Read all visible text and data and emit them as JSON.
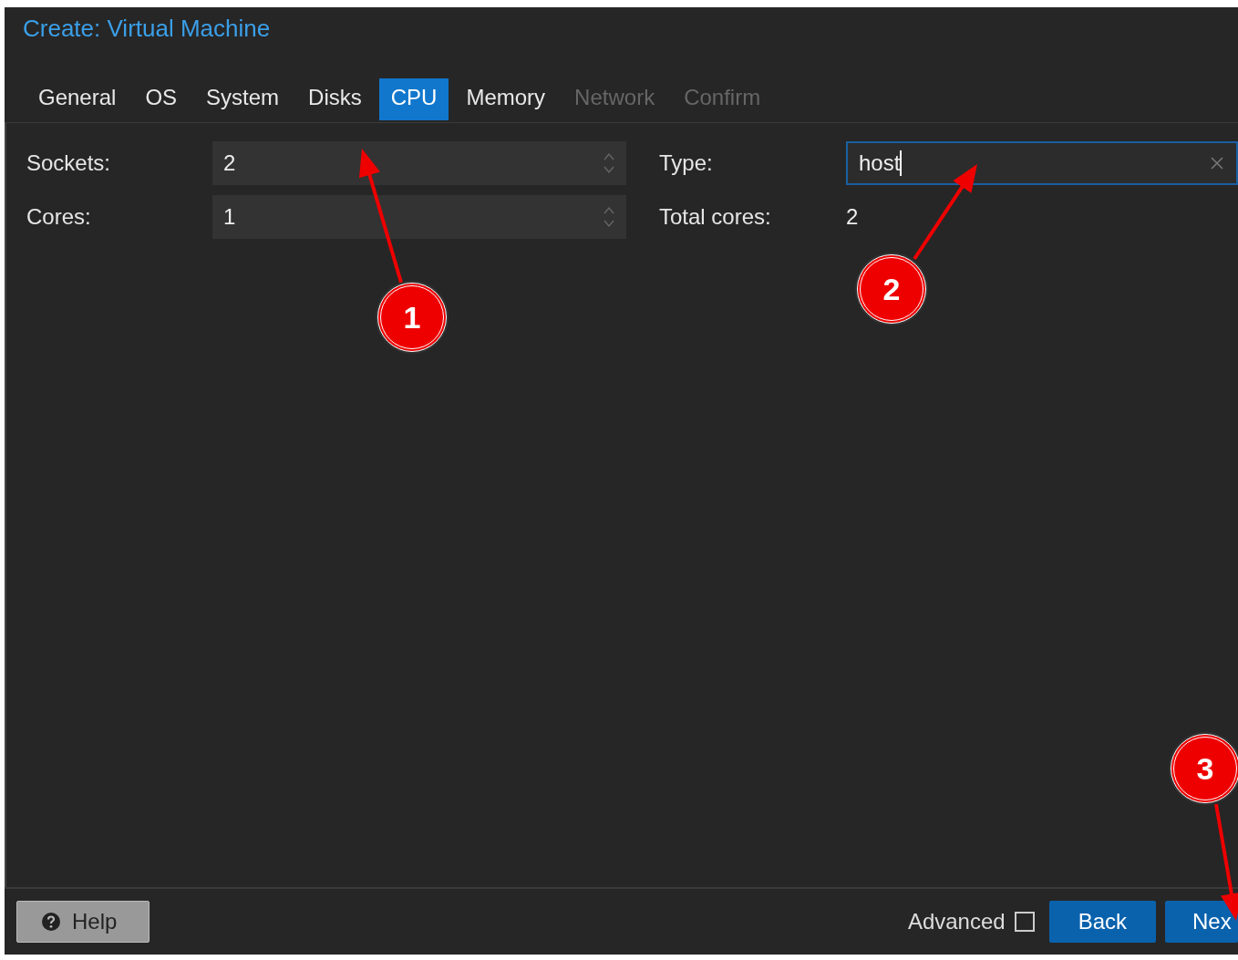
{
  "window": {
    "title": "Create: Virtual Machine"
  },
  "tabs": [
    {
      "label": "General",
      "selected": false,
      "disabled": false
    },
    {
      "label": "OS",
      "selected": false,
      "disabled": false
    },
    {
      "label": "System",
      "selected": false,
      "disabled": false
    },
    {
      "label": "Disks",
      "selected": false,
      "disabled": false
    },
    {
      "label": "CPU",
      "selected": true,
      "disabled": false
    },
    {
      "label": "Memory",
      "selected": false,
      "disabled": false
    },
    {
      "label": "Network",
      "selected": false,
      "disabled": true
    },
    {
      "label": "Confirm",
      "selected": false,
      "disabled": true
    }
  ],
  "left_fields": [
    {
      "label": "Sockets:",
      "value": "2"
    },
    {
      "label": "Cores:",
      "value": "1"
    }
  ],
  "type_field": {
    "label": "Type:",
    "value": "host"
  },
  "total_cores": {
    "label": "Total cores:",
    "value": "2"
  },
  "footer": {
    "help": "Help",
    "advanced": {
      "label": "Advanced",
      "checked": false
    },
    "buttons": [
      "Back",
      "Nex"
    ]
  },
  "annotations": [
    {
      "label": "1"
    },
    {
      "label": "2"
    },
    {
      "label": "3"
    }
  ]
}
